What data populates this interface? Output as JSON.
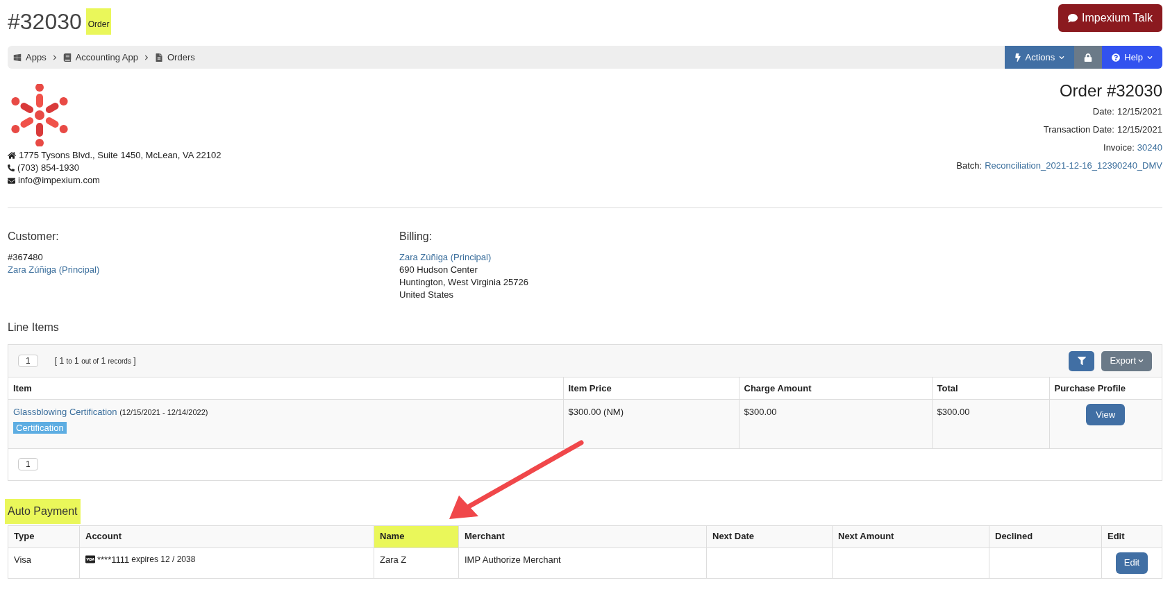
{
  "header": {
    "title": "#32030",
    "subtitle": "Order",
    "subtitle_highlighted": true,
    "talk_button": "Impexium Talk"
  },
  "breadcrumb": [
    {
      "label": "Apps",
      "kind": "apps"
    },
    {
      "label": "Accounting App",
      "kind": "book"
    },
    {
      "label": "Orders",
      "kind": "file"
    }
  ],
  "toolbar": {
    "actions": "Actions",
    "help": "Help"
  },
  "company": {
    "address": "1775 Tysons Blvd., Suite 1450, McLean, VA 22102",
    "phone": "(703) 854-1930",
    "email": "info@impexium.com"
  },
  "order": {
    "title": "Order #32030",
    "fields": [
      {
        "label": "Date:",
        "value": "12/15/2021",
        "link": false
      },
      {
        "label": "Transaction Date:",
        "value": "12/15/2021",
        "link": false
      },
      {
        "label": "Invoice:",
        "value": "30240",
        "link": true
      },
      {
        "label": "Batch:",
        "value": "Reconciliation_2021-12-16_12390240_DMV",
        "link": true
      }
    ]
  },
  "customer": {
    "heading": "Customer:",
    "number": "#367480",
    "name": "Zara Zúñiga (Principal)"
  },
  "billing": {
    "heading": "Billing:",
    "name": "Zara Zúñiga (Principal)",
    "lines": [
      "690 Hudson Center",
      "Huntington, West Virginia 25726",
      "United States"
    ]
  },
  "line_items": {
    "heading": "Line Items",
    "page": "1",
    "records": {
      "open": "[",
      "from": "1",
      "to_word": "to",
      "to": "1",
      "outof": "out of",
      "total": "1",
      "word": "records",
      "close": "]"
    },
    "export": "Export",
    "columns": [
      "Item",
      "Item Price",
      "Charge Amount",
      "Total",
      "Purchase Profile"
    ],
    "rows": [
      {
        "item": "Glassblowing Certification",
        "dates": "(12/15/2021 - 12/14/2022)",
        "tag": "Certification",
        "price": "$300.00 (NM)",
        "charge": "$300.00",
        "total": "$300.00",
        "action": "View"
      }
    ],
    "footer_page": "1"
  },
  "auto_payment": {
    "heading": "Auto Payment",
    "heading_highlighted": true,
    "columns": [
      {
        "label": "Type",
        "highlighted": false
      },
      {
        "label": "Account",
        "highlighted": false
      },
      {
        "label": "Name",
        "highlighted": true
      },
      {
        "label": "Merchant",
        "highlighted": false
      },
      {
        "label": "Next Date",
        "highlighted": false
      },
      {
        "label": "Next Amount",
        "highlighted": false
      },
      {
        "label": "Declined",
        "highlighted": false
      },
      {
        "label": "Edit",
        "highlighted": false
      }
    ],
    "rows": [
      {
        "type": "Visa",
        "account": "****1111",
        "expires": "expires 12 / 2038",
        "name": "Zara Z",
        "merchant": "IMP Authorize Merchant",
        "action": "Edit"
      }
    ]
  }
}
